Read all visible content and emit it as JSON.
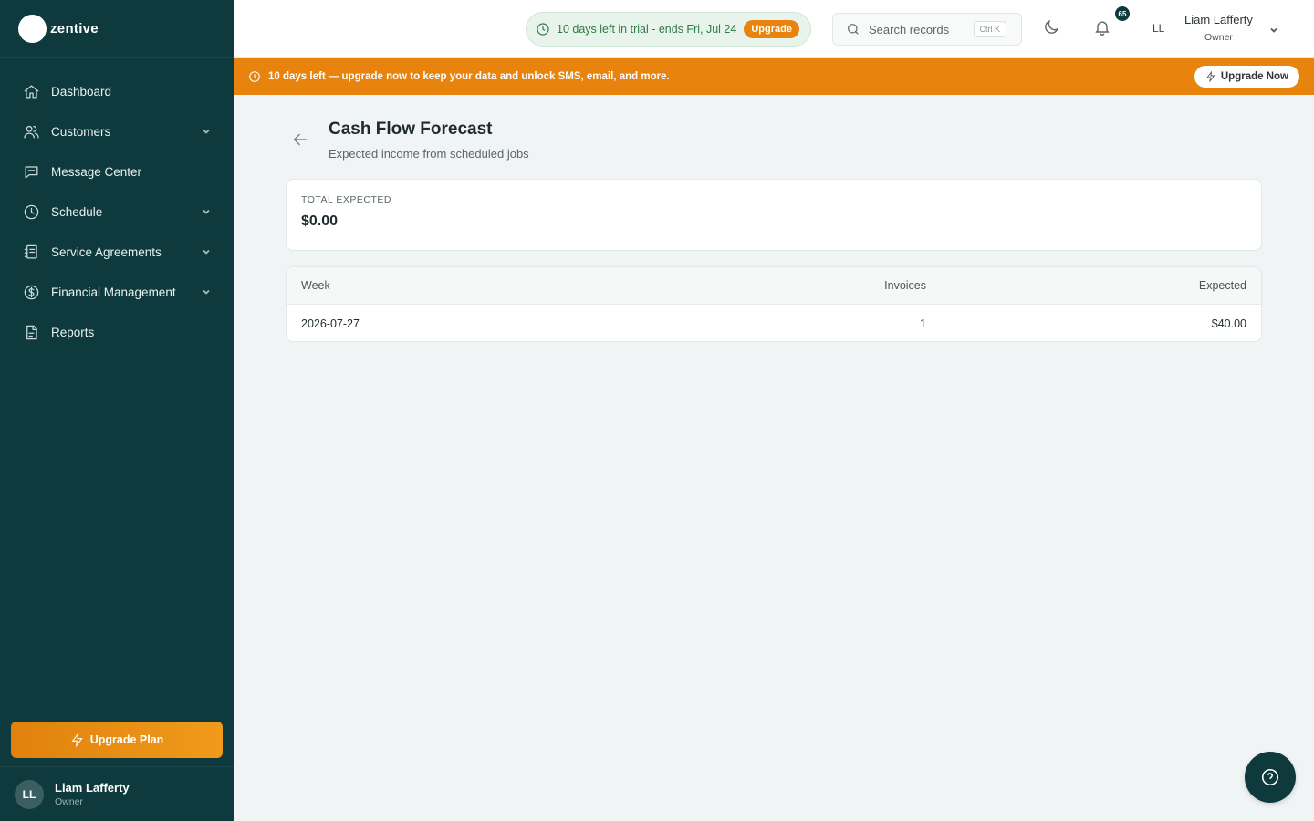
{
  "brand": {
    "name": "zentive"
  },
  "sidebar": {
    "items": [
      {
        "label": "Dashboard",
        "icon": "home-icon",
        "has_children": false
      },
      {
        "label": "Customers",
        "icon": "users-icon",
        "has_children": true
      },
      {
        "label": "Message Center",
        "icon": "message-icon",
        "has_children": false
      },
      {
        "label": "Schedule",
        "icon": "clock-icon",
        "has_children": true
      },
      {
        "label": "Service Agreements",
        "icon": "agreement-icon",
        "has_children": true
      },
      {
        "label": "Financial Management",
        "icon": "dollar-icon",
        "has_children": true
      },
      {
        "label": "Reports",
        "icon": "report-icon",
        "has_children": false
      }
    ],
    "upgrade_label": "Upgrade Plan",
    "user": {
      "initials": "LL",
      "name": "Liam Lafferty",
      "role": "Owner"
    }
  },
  "topbar": {
    "trial_text": "10 days left in trial - ends Fri, Jul 24",
    "trial_upgrade": "Upgrade",
    "search_placeholder": "Search records",
    "search_shortcut": "Ctrl K",
    "notification_count": "65",
    "initials": "LL",
    "user_name": "Liam Lafferty",
    "user_role": "Owner"
  },
  "banner": {
    "text": "10 days left — upgrade now to keep your data and unlock SMS, email, and more.",
    "button": "Upgrade Now"
  },
  "page": {
    "title": "Cash Flow Forecast",
    "subtitle": "Expected income from scheduled jobs"
  },
  "total": {
    "label": "TOTAL EXPECTED",
    "value": "$0.00"
  },
  "table": {
    "headers": {
      "week": "Week",
      "invoices": "Invoices",
      "expected": "Expected"
    },
    "rows": [
      {
        "week": "2026-07-27",
        "invoices": "1",
        "expected": "$40.00"
      }
    ]
  },
  "colors": {
    "sidebar": "#0f3a3d",
    "accent": "#e8830e",
    "trial_green": "#2e7a45"
  }
}
